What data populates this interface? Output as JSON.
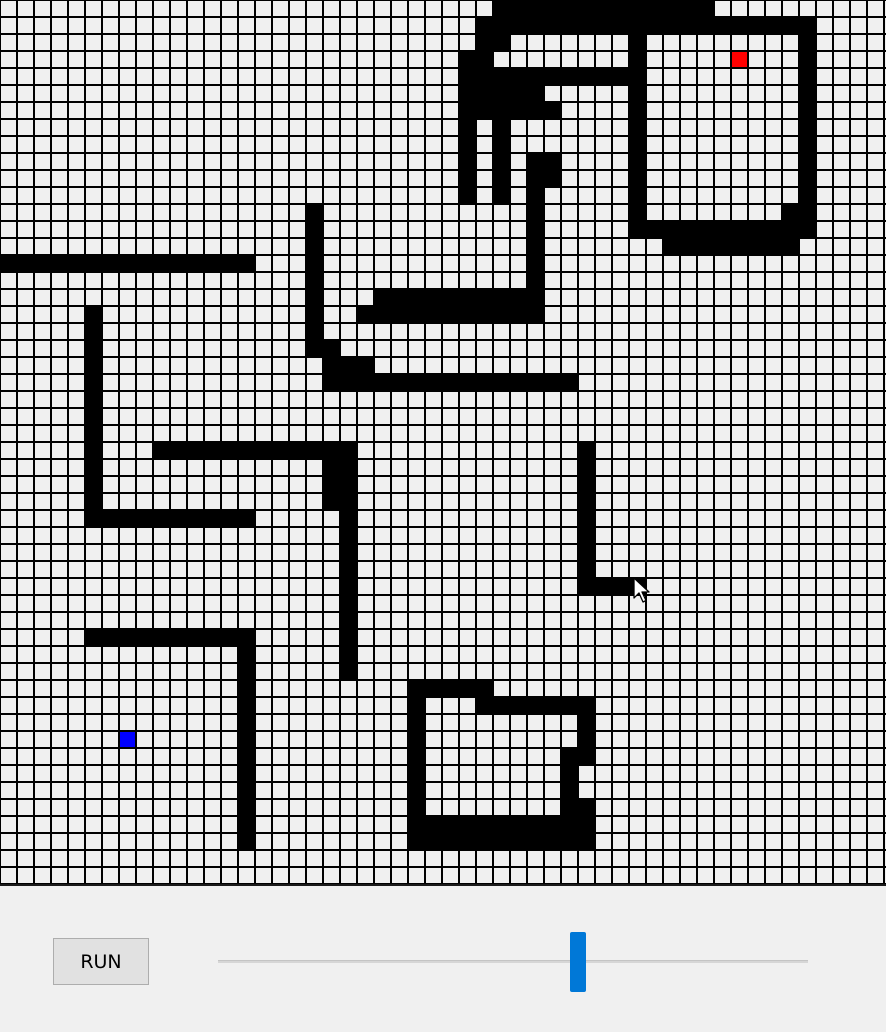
{
  "grid": {
    "cols": 52,
    "rows": 52,
    "colors": {
      "empty": "#f0f0f0",
      "line": "#000000",
      "wall": "#000000",
      "start": "#0000ff",
      "target": "#ff0000"
    },
    "start_cell": [
      7,
      43
    ],
    "target_cell": [
      43,
      3
    ],
    "walls": [
      [
        29,
        0,
        41,
        0
      ],
      [
        28,
        1,
        40,
        1
      ],
      [
        40,
        1,
        47,
        1
      ],
      [
        28,
        2,
        29,
        2
      ],
      [
        37,
        2,
        37,
        2
      ],
      [
        47,
        2,
        47,
        2
      ],
      [
        27,
        3,
        28,
        3
      ],
      [
        37,
        3,
        37,
        3
      ],
      [
        47,
        3,
        47,
        3
      ],
      [
        27,
        4,
        37,
        4
      ],
      [
        47,
        4,
        47,
        4
      ],
      [
        27,
        5,
        31,
        5
      ],
      [
        37,
        5,
        37,
        5
      ],
      [
        47,
        5,
        47,
        5
      ],
      [
        27,
        6,
        28,
        6
      ],
      [
        29,
        6,
        32,
        6
      ],
      [
        37,
        6,
        37,
        6
      ],
      [
        47,
        6,
        47,
        6
      ],
      [
        27,
        7,
        27,
        7
      ],
      [
        29,
        7,
        29,
        7
      ],
      [
        37,
        7,
        37,
        7
      ],
      [
        47,
        7,
        47,
        7
      ],
      [
        27,
        8,
        27,
        8
      ],
      [
        29,
        8,
        29,
        8
      ],
      [
        37,
        8,
        37,
        8
      ],
      [
        47,
        8,
        47,
        8
      ],
      [
        27,
        9,
        27,
        9
      ],
      [
        29,
        9,
        29,
        9
      ],
      [
        31,
        9,
        32,
        9
      ],
      [
        37,
        9,
        37,
        9
      ],
      [
        47,
        9,
        47,
        9
      ],
      [
        27,
        10,
        27,
        10
      ],
      [
        29,
        10,
        29,
        10
      ],
      [
        31,
        10,
        32,
        10
      ],
      [
        37,
        10,
        37,
        10
      ],
      [
        47,
        10,
        47,
        10
      ],
      [
        27,
        11,
        27,
        11
      ],
      [
        29,
        11,
        29,
        11
      ],
      [
        31,
        11,
        31,
        11
      ],
      [
        37,
        11,
        37,
        11
      ],
      [
        47,
        11,
        47,
        11
      ],
      [
        18,
        12,
        18,
        12
      ],
      [
        31,
        12,
        31,
        12
      ],
      [
        37,
        12,
        37,
        12
      ],
      [
        46,
        12,
        47,
        12
      ],
      [
        18,
        13,
        18,
        13
      ],
      [
        31,
        13,
        31,
        13
      ],
      [
        37,
        13,
        47,
        13
      ],
      [
        18,
        14,
        18,
        14
      ],
      [
        31,
        14,
        31,
        14
      ],
      [
        39,
        14,
        46,
        14
      ],
      [
        0,
        15,
        14,
        15
      ],
      [
        18,
        15,
        18,
        15
      ],
      [
        31,
        15,
        31,
        15
      ],
      [
        18,
        16,
        18,
        16
      ],
      [
        31,
        16,
        31,
        16
      ],
      [
        18,
        17,
        18,
        17
      ],
      [
        22,
        17,
        31,
        17
      ],
      [
        5,
        18,
        5,
        18
      ],
      [
        18,
        18,
        18,
        18
      ],
      [
        21,
        18,
        31,
        18
      ],
      [
        5,
        19,
        5,
        19
      ],
      [
        18,
        19,
        18,
        19
      ],
      [
        5,
        20,
        5,
        20
      ],
      [
        18,
        20,
        19,
        20
      ],
      [
        5,
        21,
        5,
        21
      ],
      [
        19,
        21,
        21,
        21
      ],
      [
        5,
        22,
        5,
        22
      ],
      [
        19,
        22,
        33,
        22
      ],
      [
        5,
        23,
        5,
        23
      ],
      [
        5,
        24,
        5,
        24
      ],
      [
        5,
        25,
        5,
        25
      ],
      [
        5,
        26,
        5,
        26
      ],
      [
        9,
        26,
        20,
        26
      ],
      [
        34,
        26,
        34,
        26
      ],
      [
        5,
        27,
        5,
        27
      ],
      [
        19,
        27,
        20,
        27
      ],
      [
        34,
        27,
        34,
        27
      ],
      [
        5,
        28,
        5,
        28
      ],
      [
        19,
        28,
        20,
        28
      ],
      [
        34,
        28,
        34,
        28
      ],
      [
        5,
        29,
        5,
        29
      ],
      [
        19,
        29,
        20,
        29
      ],
      [
        34,
        29,
        34,
        29
      ],
      [
        5,
        30,
        14,
        30
      ],
      [
        20,
        30,
        20,
        30
      ],
      [
        34,
        30,
        34,
        30
      ],
      [
        20,
        31,
        20,
        31
      ],
      [
        34,
        31,
        34,
        31
      ],
      [
        20,
        32,
        20,
        32
      ],
      [
        34,
        32,
        34,
        32
      ],
      [
        20,
        33,
        20,
        33
      ],
      [
        34,
        33,
        34,
        33
      ],
      [
        20,
        34,
        20,
        34
      ],
      [
        34,
        34,
        37,
        34
      ],
      [
        20,
        35,
        20,
        35
      ],
      [
        20,
        36,
        20,
        36
      ],
      [
        5,
        37,
        14,
        37
      ],
      [
        20,
        37,
        20,
        37
      ],
      [
        14,
        38,
        14,
        38
      ],
      [
        20,
        38,
        20,
        38
      ],
      [
        14,
        39,
        14,
        39
      ],
      [
        20,
        39,
        20,
        39
      ],
      [
        14,
        40,
        14,
        40
      ],
      [
        24,
        40,
        28,
        40
      ],
      [
        14,
        41,
        14,
        41
      ],
      [
        24,
        41,
        24,
        41
      ],
      [
        28,
        41,
        34,
        41
      ],
      [
        14,
        42,
        14,
        42
      ],
      [
        24,
        42,
        24,
        42
      ],
      [
        34,
        42,
        34,
        42
      ],
      [
        14,
        43,
        14,
        43
      ],
      [
        24,
        43,
        24,
        43
      ],
      [
        34,
        43,
        34,
        43
      ],
      [
        14,
        44,
        14,
        44
      ],
      [
        24,
        44,
        24,
        44
      ],
      [
        33,
        44,
        34,
        44
      ],
      [
        14,
        45,
        14,
        45
      ],
      [
        24,
        45,
        24,
        45
      ],
      [
        33,
        45,
        33,
        45
      ],
      [
        14,
        46,
        14,
        46
      ],
      [
        24,
        46,
        24,
        46
      ],
      [
        33,
        46,
        33,
        46
      ],
      [
        14,
        47,
        14,
        47
      ],
      [
        24,
        47,
        24,
        47
      ],
      [
        33,
        47,
        34,
        47
      ],
      [
        14,
        48,
        14,
        48
      ],
      [
        24,
        48,
        34,
        48
      ],
      [
        14,
        49,
        14,
        49
      ],
      [
        24,
        49,
        34,
        49
      ]
    ]
  },
  "controls": {
    "run_label": "RUN",
    "speed_value": 0.61,
    "accent_color": "#0078d7"
  },
  "icons": {
    "cursor": "arrow-cursor-icon"
  }
}
